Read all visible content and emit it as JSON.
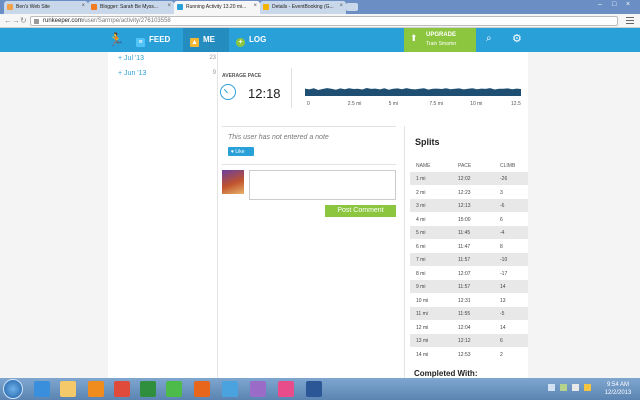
{
  "browser": {
    "tabs": [
      {
        "title": "Ben's Web Site",
        "favicon_color": "#f4a24a"
      },
      {
        "title": "Blogger: Sarah Be Myss...",
        "favicon_color": "#f47b20"
      },
      {
        "title": "Running Activity 13.20 mi...",
        "favicon_color": "#2aa0d8"
      },
      {
        "title": "Details - EventBooking (G...",
        "favicon_color": "#f2b400"
      }
    ],
    "url_host": "runkeeper.com",
    "url_path": "/user/Sarrnpe/activity/276103558"
  },
  "header": {
    "nav": [
      {
        "label": "FEED",
        "icon": "feed-icon",
        "color": "#4fc3f7"
      },
      {
        "label": "ME",
        "icon": "me-icon",
        "color": "#f6b733"
      },
      {
        "label": "LOG",
        "icon": "plus-icon",
        "color": "#8cc63f"
      }
    ],
    "upgrade_title": "UPGRADE",
    "upgrade_sub": "Train Smarter"
  },
  "months": [
    {
      "label": "Jul '13",
      "count": "23"
    },
    {
      "label": "Jun '13",
      "count": "9"
    }
  ],
  "pace": {
    "label": "AVERAGE PACE",
    "value": "12:18",
    "x_ticks": [
      "0",
      "2.5 mi",
      "5 mi",
      "7.5 mi",
      "10 mi",
      "12.5 mi"
    ],
    "series": [
      0.62,
      0.55,
      0.64,
      0.5,
      0.58,
      0.66,
      0.6,
      0.52,
      0.63,
      0.57,
      0.65,
      0.58,
      0.61,
      0.54,
      0.67,
      0.59,
      0.62,
      0.55,
      0.64,
      0.52,
      0.6,
      0.63,
      0.57,
      0.66,
      0.58,
      0.55,
      0.61,
      0.64,
      0.53,
      0.6,
      0.62,
      0.58,
      0.65,
      0.56,
      0.61,
      0.63,
      0.55,
      0.6,
      0.64,
      0.57,
      0.62,
      0.59,
      0.66,
      0.54,
      0.61,
      0.6,
      0.63,
      0.57,
      0.62,
      0.58
    ]
  },
  "note": {
    "text": "This user has not entered a note",
    "like_label": "Like"
  },
  "comment": {
    "post_label": "Post Comment"
  },
  "splits": {
    "title": "Splits",
    "headers": [
      "NAME",
      "PACE",
      "CLIMB"
    ],
    "rows": [
      [
        "1 mi",
        "12:02",
        "-26"
      ],
      [
        "2 mi",
        "12:23",
        "3"
      ],
      [
        "3 mi",
        "12:13",
        "-6"
      ],
      [
        "4 mi",
        "15:00",
        "6"
      ],
      [
        "5 mi",
        "11:45",
        "-4"
      ],
      [
        "6 mi",
        "11:47",
        "8"
      ],
      [
        "7 mi",
        "11:57",
        "-10"
      ],
      [
        "8 mi",
        "12:07",
        "-17"
      ],
      [
        "9 mi",
        "11:57",
        "14"
      ],
      [
        "10 mi",
        "12:31",
        "13"
      ],
      [
        "11 mi",
        "11:55",
        "-5"
      ],
      [
        "12 mi",
        "12:04",
        "14"
      ],
      [
        "13 mi",
        "12:12",
        "6"
      ],
      [
        "14 mi",
        "12:53",
        "2"
      ]
    ],
    "completed_label": "Completed With:"
  },
  "taskbar": {
    "time": "9:54 AM",
    "date": "12/2/2013",
    "apps": [
      {
        "name": "ie-icon",
        "color": "#3a8fdc"
      },
      {
        "name": "explorer-icon",
        "color": "#f3c969"
      },
      {
        "name": "outlook-icon",
        "color": "#f08b1d"
      },
      {
        "name": "chrome-icon",
        "color": "#e04a3b"
      },
      {
        "name": "excel-icon",
        "color": "#2f8f3e"
      },
      {
        "name": "game-icon",
        "color": "#4cbb4a"
      },
      {
        "name": "firefox-icon",
        "color": "#e8661c"
      },
      {
        "name": "iphoto-icon",
        "color": "#4aa3df"
      },
      {
        "name": "messenger-icon",
        "color": "#9b6cc7"
      },
      {
        "name": "paint-icon",
        "color": "#e84c8b"
      },
      {
        "name": "word-icon",
        "color": "#2b5797"
      },
      {
        "name": "powerpoint-icon",
        "color": "#d24726"
      }
    ]
  }
}
